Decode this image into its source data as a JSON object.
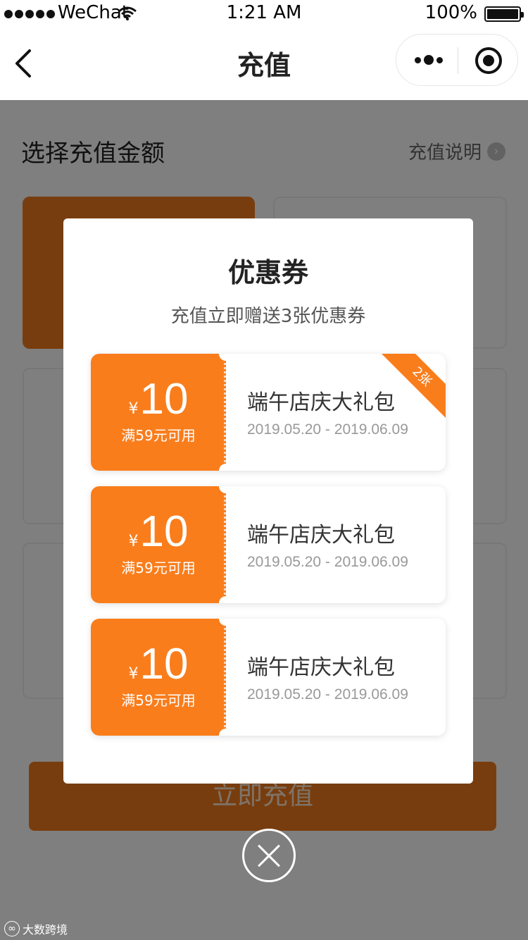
{
  "status_bar": {
    "carrier": "WeChat",
    "time": "1:21 AM",
    "battery": "100%"
  },
  "nav": {
    "title": "充值"
  },
  "page": {
    "section_title": "选择充值金额",
    "recharge_note": "充值说明",
    "recharge_button": "立即充值"
  },
  "modal": {
    "title": "优惠券",
    "subtitle": "充值立即赠送3张优惠券",
    "coupons": [
      {
        "currency": "¥",
        "amount": "10",
        "condition": "满59元可用",
        "name": "端午店庆大礼包",
        "dates": "2019.05.20 - 2019.06.09",
        "badge": "2张"
      },
      {
        "currency": "¥",
        "amount": "10",
        "condition": "满59元可用",
        "name": "端午店庆大礼包",
        "dates": "2019.05.20 - 2019.06.09"
      },
      {
        "currency": "¥",
        "amount": "10",
        "condition": "满59元可用",
        "name": "端午店庆大礼包",
        "dates": "2019.05.20 - 2019.06.09"
      }
    ]
  },
  "watermark": {
    "text": "大数跨境"
  },
  "colors": {
    "accent": "#fa7d1c",
    "mask": "rgba(0,0,0,0.5)"
  }
}
